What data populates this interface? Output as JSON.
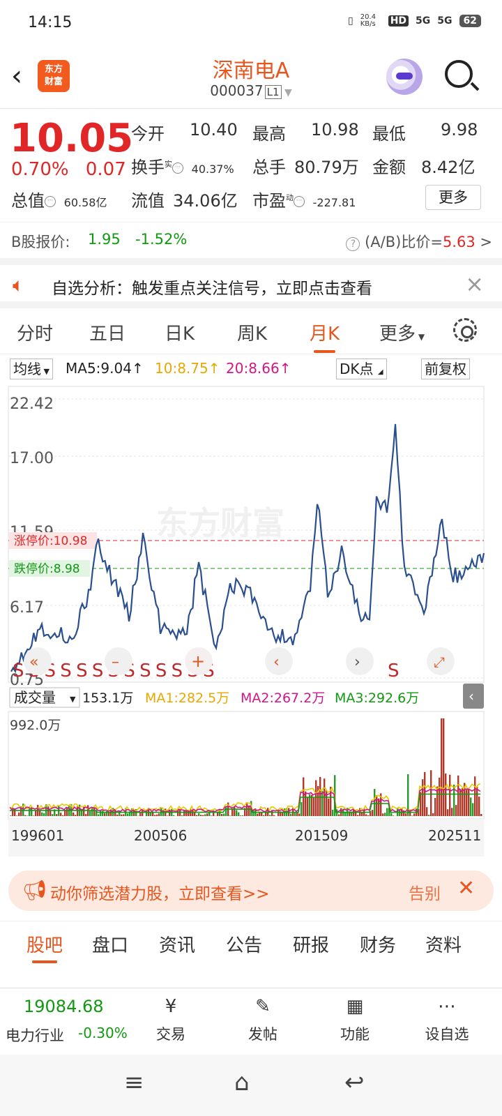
{
  "status_bar": {
    "time": "14:15",
    "net_speed": "20.4 KB/s",
    "hd": "HD",
    "signal1": "5G",
    "signal2": "5G",
    "battery": "62"
  },
  "header": {
    "logo_text": "东方财富",
    "stock_name": "深南电A",
    "stock_code": "000037",
    "level_badge": "L1"
  },
  "quote": {
    "price": "10.05",
    "change_pct": "0.70%",
    "change_amt": "0.07",
    "open_label": "今开",
    "open": "10.40",
    "high_label": "最高",
    "high": "10.98",
    "low_label": "最低",
    "low": "9.98",
    "turnover_label": "换手",
    "turnover_sup": "实",
    "turnover": "40.37%",
    "volume_label": "总手",
    "volume": "80.79万",
    "amount_label": "金额",
    "amount": "8.42亿",
    "total_mv_label": "总值",
    "total_mv": "60.58亿",
    "float_mv_label": "流值",
    "float_mv": "34.06亿",
    "pe_label": "市盈",
    "pe_sup": "动",
    "pe": "-227.81",
    "more_label": "更多"
  },
  "bshare": {
    "label": "B股报价:",
    "price": "1.95",
    "change": "-1.52%",
    "ratio_label": "(A/B)比价=",
    "ratio": "5.63",
    "arrow": ">"
  },
  "alert": {
    "text": "自选分析：触发重点关注信号，立即点击查看"
  },
  "tabs": [
    "分时",
    "五日",
    "日K",
    "周K",
    "月K",
    "更多"
  ],
  "ma_row": {
    "selector": "均线",
    "ma5": "MA5:9.04",
    "ma10": "10:8.75",
    "ma20": "20:8.66",
    "dk": "DK点",
    "adjust": "前复权"
  },
  "kline": {
    "y_labels": [
      "22.42",
      "17.00",
      "11.59",
      "6.17",
      "0.75"
    ],
    "limit_up_label": "涨停价:10.98",
    "limit_down_label": "跌停价:8.98",
    "watermark": "东方财富",
    "s_marks": "S S S S S S S S S S S S S",
    "s_mark2": "S",
    "s_mark3": "S"
  },
  "volume_row": {
    "selector": "成交量",
    "vol": "153.1万",
    "ma1": "MA1:282.5万",
    "ma2": "MA2:267.2万",
    "ma3": "MA3:292.6万",
    "max_label": "992.0万"
  },
  "x_labels": [
    "199601",
    "200506",
    "201509",
    "202511"
  ],
  "ad": {
    "text": "动你筛选潜力股，立即查看>>",
    "tip": "告别"
  },
  "subtabs": [
    "股吧",
    "盘口",
    "资讯",
    "公告",
    "研报",
    "财务",
    "资料"
  ],
  "bottom_bar": {
    "index_value": "19084.68",
    "index_name": "电力行业",
    "index_pct": "-0.30%",
    "items": [
      "交易",
      "发帖",
      "功能",
      "设自选"
    ]
  },
  "colors": {
    "up": "#e02626",
    "down": "#119911",
    "accent": "#e8561f",
    "line": "#2a4f8f"
  }
}
